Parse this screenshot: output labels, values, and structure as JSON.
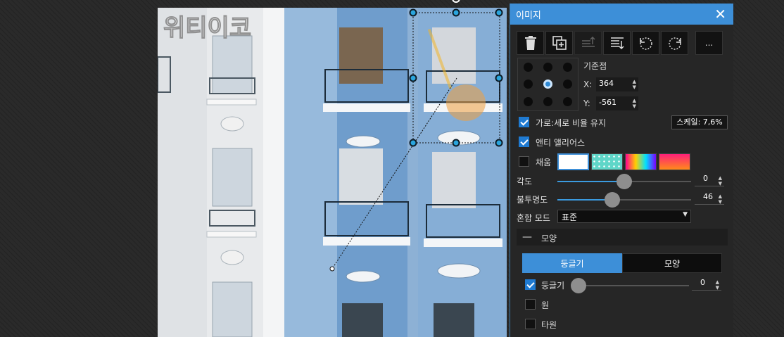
{
  "canvas": {
    "watermark": "위티이코"
  },
  "panel": {
    "title": "이미지",
    "toolbar": [
      {
        "name": "delete-icon"
      },
      {
        "name": "duplicate-icon"
      },
      {
        "name": "bring-forward-icon"
      },
      {
        "name": "send-backward-icon"
      },
      {
        "name": "rotate-left-icon"
      },
      {
        "name": "rotate-right-icon"
      }
    ],
    "more_label": "...",
    "anchor": {
      "label": "기준점",
      "x_label": "X:",
      "x_value": "364",
      "y_label": "Y:",
      "y_value": "-561",
      "selected_index": 4
    },
    "keep_ratio": {
      "label": "가로:세로 비율 유지",
      "checked": true
    },
    "scale_label": "스케일: 7,6%",
    "antialias": {
      "label": "앤티 앨리어스",
      "checked": true
    },
    "fill": {
      "label": "채움",
      "checked": false,
      "swatch_colors": [
        "#ffffff",
        "#5fd6c8",
        "#e040a0",
        "#ff2a6a"
      ]
    },
    "angle": {
      "label": "각도",
      "value": "0",
      "fraction": 0.5
    },
    "opacity": {
      "label": "불투명도",
      "value": "46",
      "fraction": 0.41
    },
    "blend": {
      "label": "혼합 모드",
      "value": "표준"
    },
    "shape_section": {
      "label": "모양"
    },
    "tabs": [
      {
        "label": "둥글기",
        "active": true
      },
      {
        "label": "모양",
        "active": false
      }
    ],
    "rounding": {
      "label": "둥글기",
      "checked": true,
      "value": "0",
      "fraction": 0.0
    },
    "circle": {
      "label": "원",
      "checked": false
    },
    "ellipse": {
      "label": "타원",
      "checked": false
    }
  },
  "colors": {
    "accent": "#3d8fd8",
    "panel_bg": "#262626",
    "handle": "#2aa5dd",
    "building_blue": "#8fb3d6"
  }
}
